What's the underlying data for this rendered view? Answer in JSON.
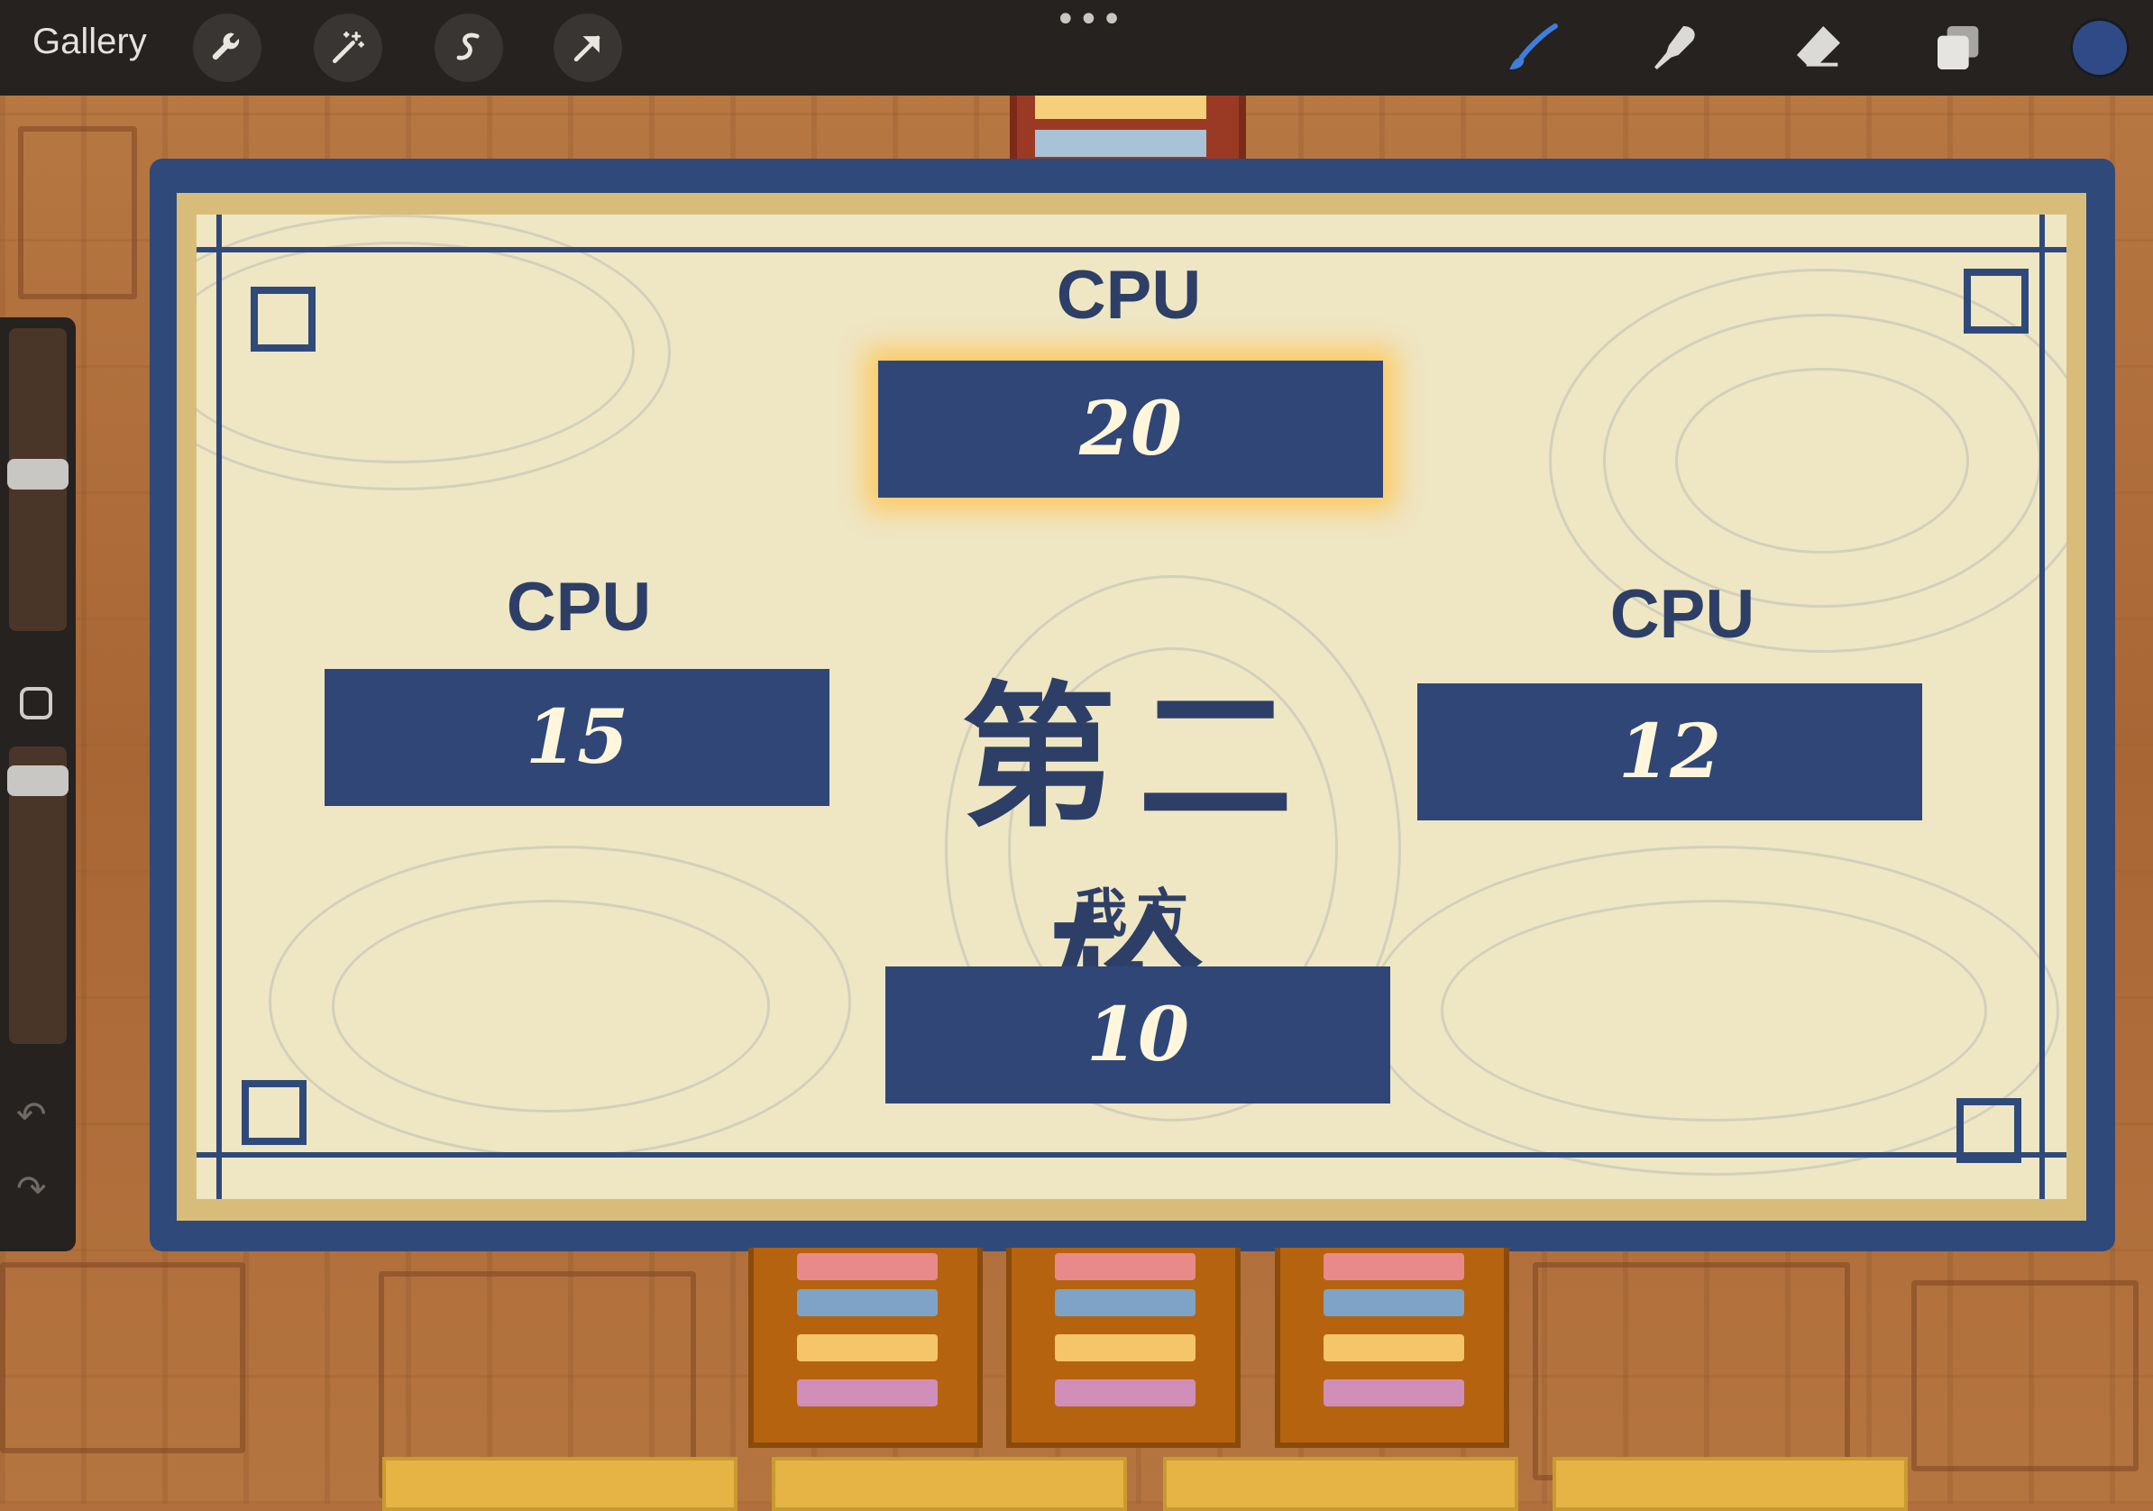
{
  "toolbar": {
    "gallery_label": "Gallery",
    "tools": [
      {
        "name": "wrench-icon"
      },
      {
        "name": "magic-wand-icon"
      },
      {
        "name": "selection-icon"
      },
      {
        "name": "transform-arrow-icon"
      }
    ],
    "right_tools": [
      {
        "name": "brush-icon"
      },
      {
        "name": "smudge-icon"
      },
      {
        "name": "eraser-icon"
      },
      {
        "name": "layers-icon"
      }
    ],
    "more_label": "•••",
    "current_color": "#2f4a86"
  },
  "sidebar": {
    "brush_size_level": 0.52,
    "opacity_level": 0.93,
    "undo_icon": "undo-icon",
    "redo_icon": "redo-icon"
  },
  "board": {
    "top_player": {
      "label": "CPU",
      "score": "20",
      "active": true
    },
    "left_player": {
      "label": "CPU",
      "score": "15"
    },
    "right_player": {
      "label": "CPU",
      "score": "12"
    },
    "bottom_player": {
      "label": "我方",
      "score": "10"
    },
    "round_title": "第二轮"
  },
  "colors": {
    "panel_blue": "#2f4a7a",
    "paper": "#efe6c4",
    "wood": "#b06f3c",
    "highlight_glow": "#ffc450"
  }
}
